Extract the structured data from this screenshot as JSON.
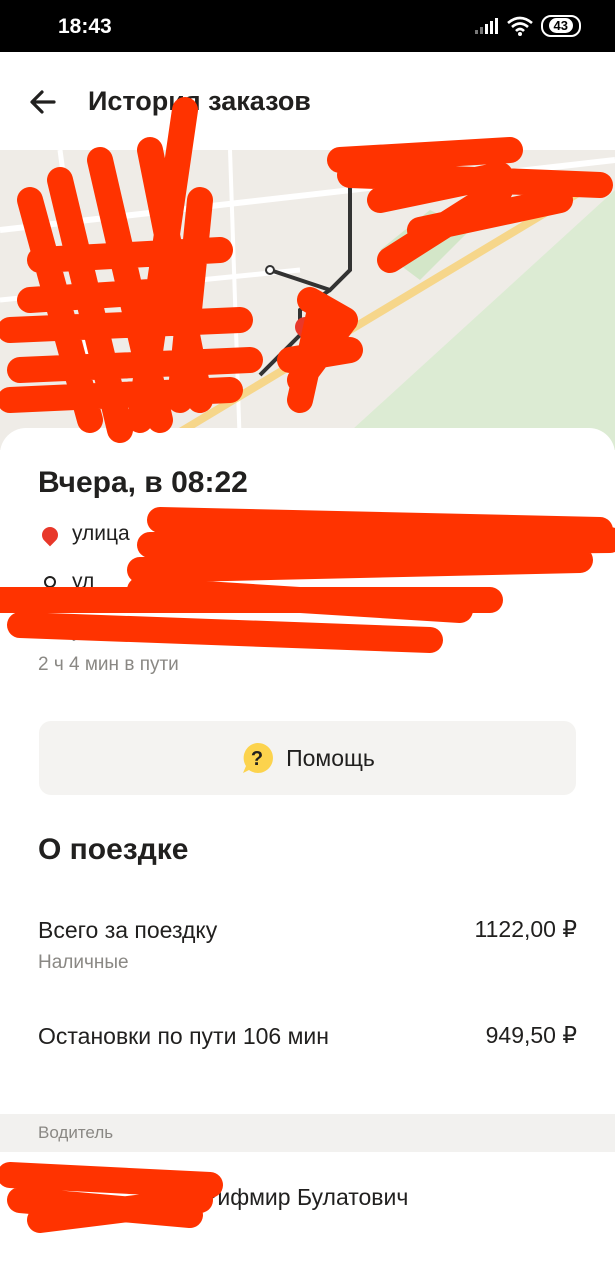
{
  "status_bar": {
    "time": "18:43",
    "battery": "43"
  },
  "header": {
    "title": "История заказов"
  },
  "trip": {
    "date": "Вчера, в 08:22",
    "route": [
      {
        "label": "улица"
      },
      {
        "label": "ул"
      },
      {
        "label": "у"
      }
    ],
    "duration": "2 ч 4 мин в пути"
  },
  "help": {
    "label": "Помощь"
  },
  "about": {
    "title": "О поездке",
    "total_label": "Всего за поездку",
    "total_value": "1122,00 ₽",
    "payment_method": "Наличные",
    "stops_label": "Остановки по пути 106 мин",
    "stops_value": "949,50 ₽"
  },
  "driver": {
    "section_label": "Водитель",
    "name": "Рифмир Булатович"
  },
  "colors": {
    "accent_red": "#e8382a",
    "scribble": "#ff3300",
    "help_icon": "#fcd34d",
    "secondary_text": "#8a8884"
  }
}
